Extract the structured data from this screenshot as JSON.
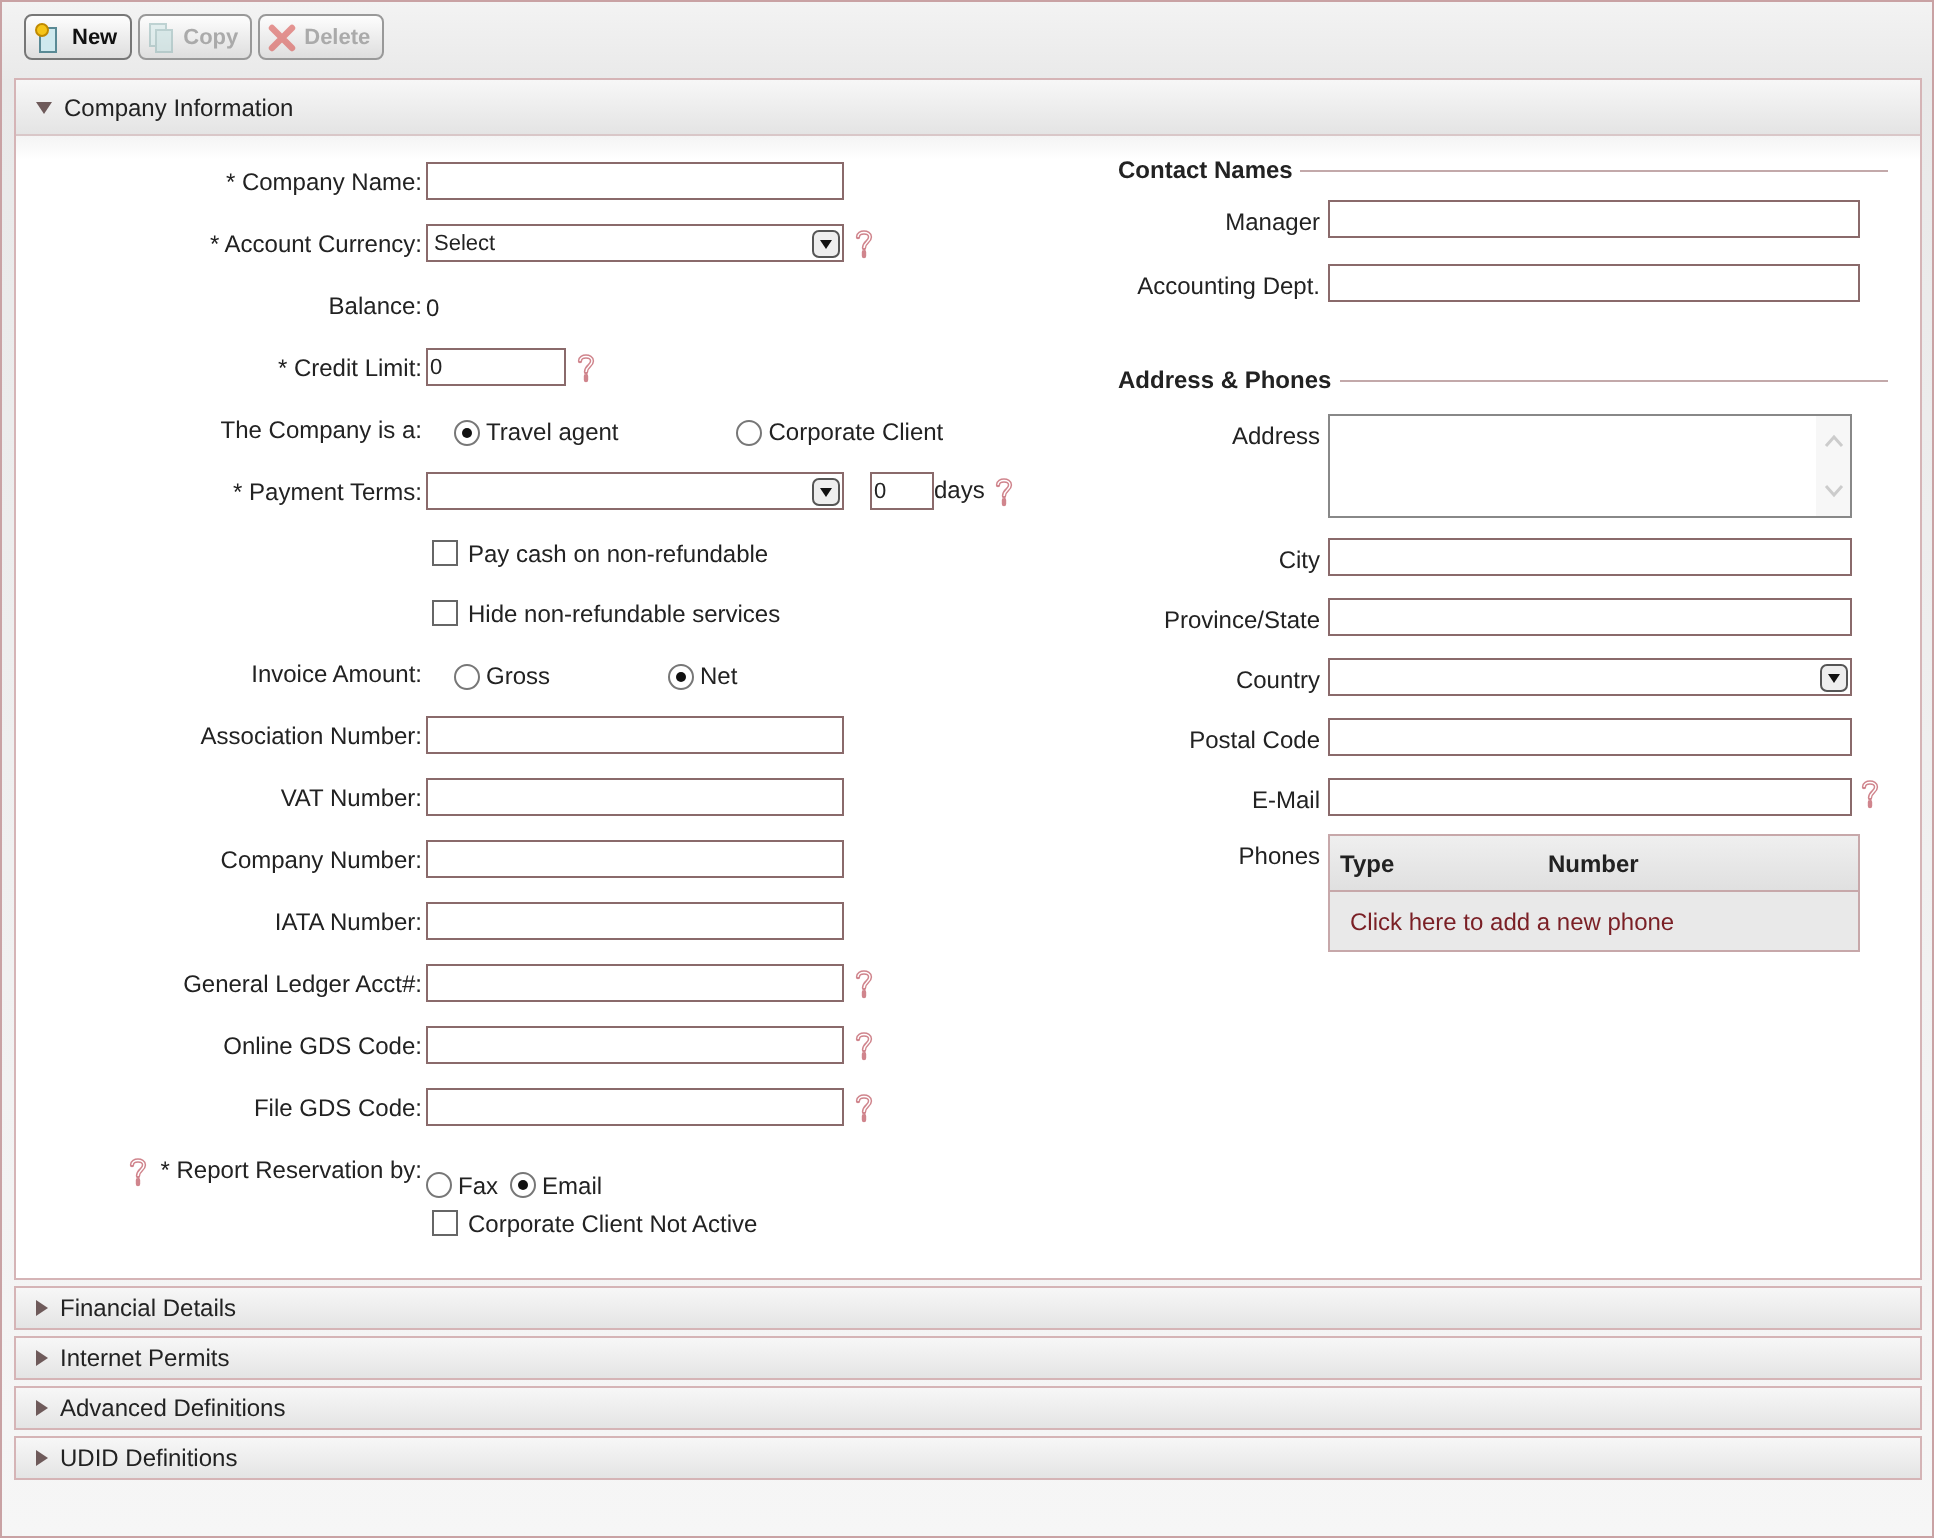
{
  "toolbar": [
    {
      "kind": "new",
      "label": "New",
      "disabled": false
    },
    {
      "kind": "copy",
      "label": "Copy",
      "disabled": true
    },
    {
      "kind": "delete",
      "label": "Delete",
      "disabled": true
    }
  ],
  "company_information": {
    "title": "Company Information",
    "expanded": true,
    "left_fields": [
      {
        "kind": "text",
        "label": "* Company Name:",
        "help": false
      },
      {
        "kind": "select",
        "label": "* Account Currency:",
        "value": "Select",
        "help": true
      },
      {
        "kind": "static",
        "label": "Balance:",
        "value": "0"
      },
      {
        "kind": "number",
        "label": "* Credit Limit:",
        "value": "0",
        "help": true
      },
      {
        "kind": "radio",
        "label": "The Company is a:",
        "options": [
          {
            "label": "Travel agent",
            "selected": true
          },
          {
            "label": "Corporate Client",
            "selected": false
          }
        ]
      },
      {
        "kind": "select_days",
        "label": "* Payment Terms:",
        "days_value": "0",
        "days_label": "days",
        "help": true
      },
      {
        "kind": "checkbox",
        "label": "Pay cash on non-refundable",
        "checked": false
      },
      {
        "kind": "checkbox",
        "label": "Hide non-refundable services",
        "checked": false
      },
      {
        "kind": "radio",
        "label": "Invoice Amount:",
        "options": [
          {
            "label": "Gross",
            "selected": false
          },
          {
            "label": "Net",
            "selected": true
          }
        ]
      },
      {
        "kind": "text",
        "label": "Association Number:",
        "help": false
      },
      {
        "kind": "text",
        "label": "VAT Number:",
        "help": false
      },
      {
        "kind": "text",
        "label": "Company Number:",
        "help": false
      },
      {
        "kind": "text",
        "label": "IATA Number:",
        "help": false
      },
      {
        "kind": "text",
        "label": "General Ledger Acct#:",
        "help": true
      },
      {
        "kind": "text",
        "label": "Online GDS Code:",
        "help": true
      },
      {
        "kind": "text",
        "label": "File GDS Code:",
        "help": true
      },
      {
        "kind": "radio_compact",
        "label": "* Report Reservation by:",
        "help": true,
        "options": [
          {
            "label": "Fax",
            "selected": false
          },
          {
            "label": "Email",
            "selected": true
          }
        ]
      },
      {
        "kind": "checkbox",
        "label": "Corporate Client Not Active",
        "checked": false
      }
    ],
    "contact_names": {
      "heading": "Contact Names",
      "fields": [
        {
          "kind": "text",
          "label": "Manager"
        },
        {
          "kind": "text",
          "label": "Accounting Dept."
        }
      ]
    },
    "address_phones": {
      "heading": "Address & Phones",
      "fields": [
        {
          "kind": "textarea",
          "label": "Address",
          "help": false
        },
        {
          "kind": "text",
          "label": "City",
          "help": false
        },
        {
          "kind": "text",
          "label": "Province/State",
          "help": false
        },
        {
          "kind": "select",
          "label": "Country",
          "help": false
        },
        {
          "kind": "text",
          "label": "Postal Code",
          "help": false
        },
        {
          "kind": "text",
          "label": "E-Mail",
          "help": true
        }
      ],
      "phones": {
        "label": "Phones",
        "columns": [
          "Type",
          "Number"
        ],
        "add_link": "Click here to add a new phone"
      }
    }
  },
  "collapsed_sections": [
    {
      "title": "Financial Details",
      "expanded": false
    },
    {
      "title": "Internet Permits",
      "expanded": false
    },
    {
      "title": "Advanced Definitions",
      "expanded": false
    },
    {
      "title": "UDID Definitions",
      "expanded": false
    }
  ]
}
